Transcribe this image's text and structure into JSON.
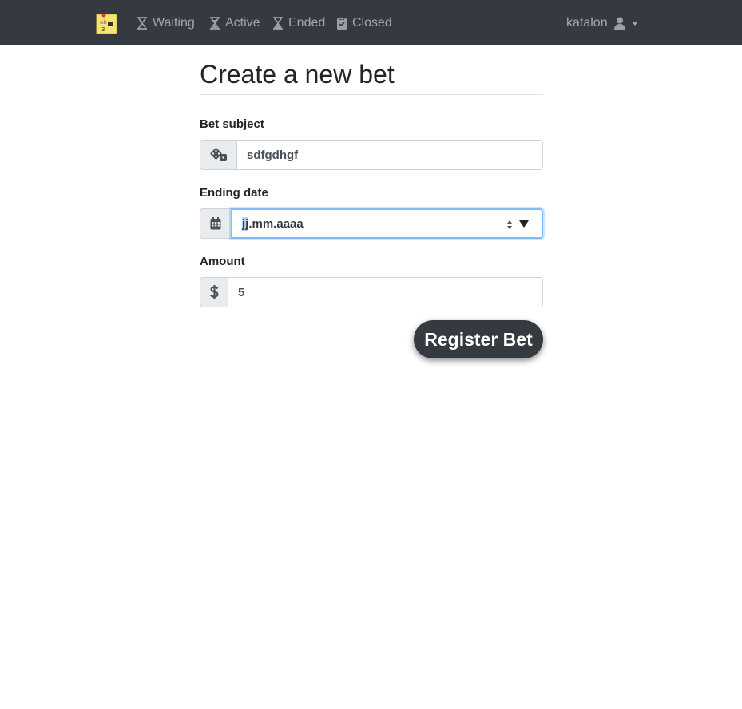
{
  "navbar": {
    "brand_icon": "sticky-note-logo-icon",
    "links": [
      {
        "label": "Waiting",
        "icon": "hourglass-start-icon"
      },
      {
        "label": "Active",
        "icon": "hourglass-half-icon"
      },
      {
        "label": "Ended",
        "icon": "hourglass-end-icon"
      },
      {
        "label": "Closed",
        "icon": "clipboard-check-icon"
      }
    ],
    "user": {
      "name": "katalon",
      "icon": "user-icon"
    }
  },
  "form": {
    "title": "Create a new bet",
    "subject": {
      "label": "Bet subject",
      "value": "sdfgdhgf",
      "icon": "dice-icon"
    },
    "ending_date": {
      "label": "Ending date",
      "selected_part": "jj",
      "rest": ".mm.aaaa",
      "icon": "calendar-icon"
    },
    "amount": {
      "label": "Amount",
      "value": "5",
      "icon": "dollar-icon"
    },
    "submit_label": "Register Bet"
  },
  "colors": {
    "navbar_bg": "#343a40",
    "focus_border": "#80bdff",
    "button_bg": "#343a40"
  }
}
